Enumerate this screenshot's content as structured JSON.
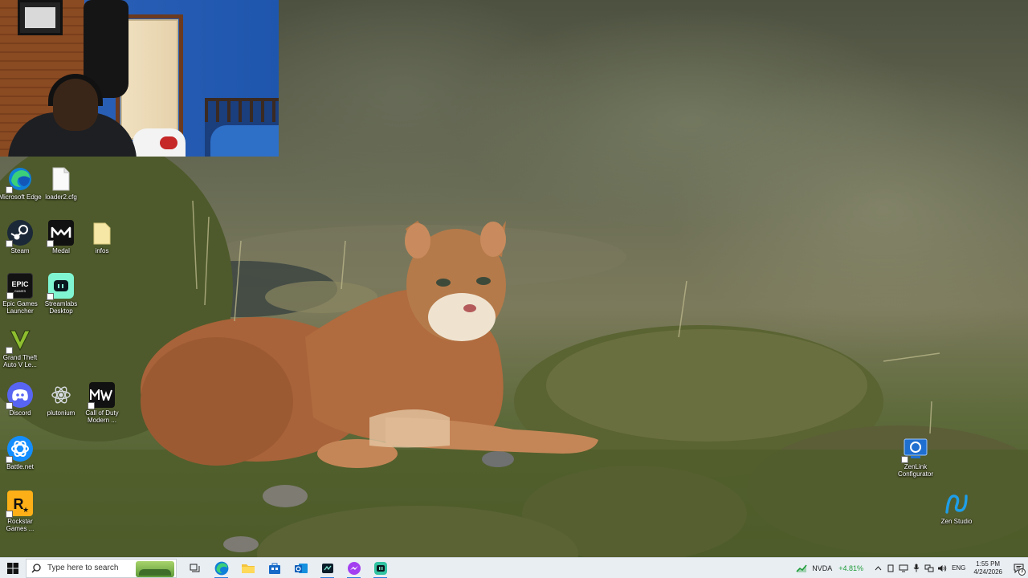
{
  "desktop": {
    "icons": [
      {
        "name": "microsoft-edge",
        "label": "Microsoft Edge"
      },
      {
        "name": "loader2-cfg",
        "label": "loader2.cfg"
      },
      {
        "name": "steam",
        "label": "Steam"
      },
      {
        "name": "medal",
        "label": "Medal"
      },
      {
        "name": "infos",
        "label": "infos"
      },
      {
        "name": "epic-games-launcher",
        "label": "Epic Games Launcher"
      },
      {
        "name": "streamlabs-desktop",
        "label": "Streamlabs Desktop"
      },
      {
        "name": "grand-theft-auto",
        "label": "Grand Theft Auto V Le..."
      },
      {
        "name": "discord",
        "label": "Discord"
      },
      {
        "name": "plutonium",
        "label": "plutonium"
      },
      {
        "name": "call-of-duty",
        "label": "Call of Duty Modern ..."
      },
      {
        "name": "battle-net",
        "label": "Battle.net"
      },
      {
        "name": "rockstar-games",
        "label": "Rockstar Games ..."
      },
      {
        "name": "zenlink-configurator",
        "label": "ZenLink Configurator"
      },
      {
        "name": "zen-studio",
        "label": "Zen Studio"
      }
    ],
    "brand_colors": {
      "steam": "#1b2838",
      "medal": "#111111",
      "streamlabs": "#80f5d2",
      "discord": "#5865f2",
      "battle_net": "#148eff",
      "rockstar": "#fcaf17",
      "epic": "#121212"
    }
  },
  "taskbar": {
    "search_placeholder": "Type here to search",
    "apps": [
      "task-view-icon",
      "edge-icon",
      "file-explorer-icon",
      "store-icon",
      "outlook-icon",
      "media-icon",
      "messenger-icon",
      "streamlabs-icon"
    ],
    "stock": {
      "symbol": "NVDA",
      "change": "+4.81%"
    },
    "language": "ENG",
    "time": "1:55 PM",
    "date": "4/24/2026",
    "notification_count": "3",
    "accent_color": "#2b7de0"
  }
}
